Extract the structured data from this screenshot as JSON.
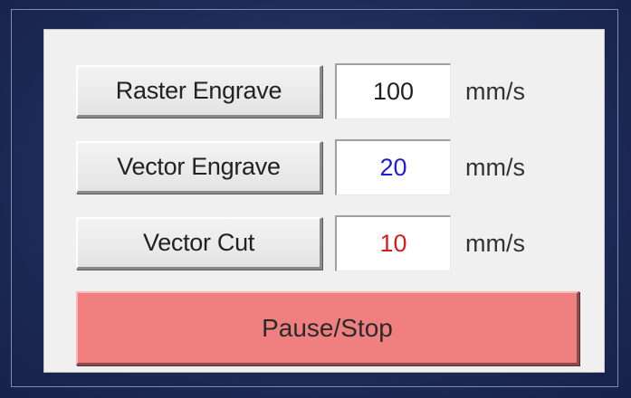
{
  "speeds": {
    "raster_engrave": {
      "label": "Raster Engrave",
      "value": "100",
      "unit": "mm/s",
      "value_color": "#222222"
    },
    "vector_engrave": {
      "label": "Vector Engrave",
      "value": "20",
      "unit": "mm/s",
      "value_color": "#1f1fd0"
    },
    "vector_cut": {
      "label": "Vector Cut",
      "value": "10",
      "unit": "mm/s",
      "value_color": "#d41f1f"
    }
  },
  "pause_stop": {
    "label": "Pause/Stop",
    "color": "#f08080"
  }
}
